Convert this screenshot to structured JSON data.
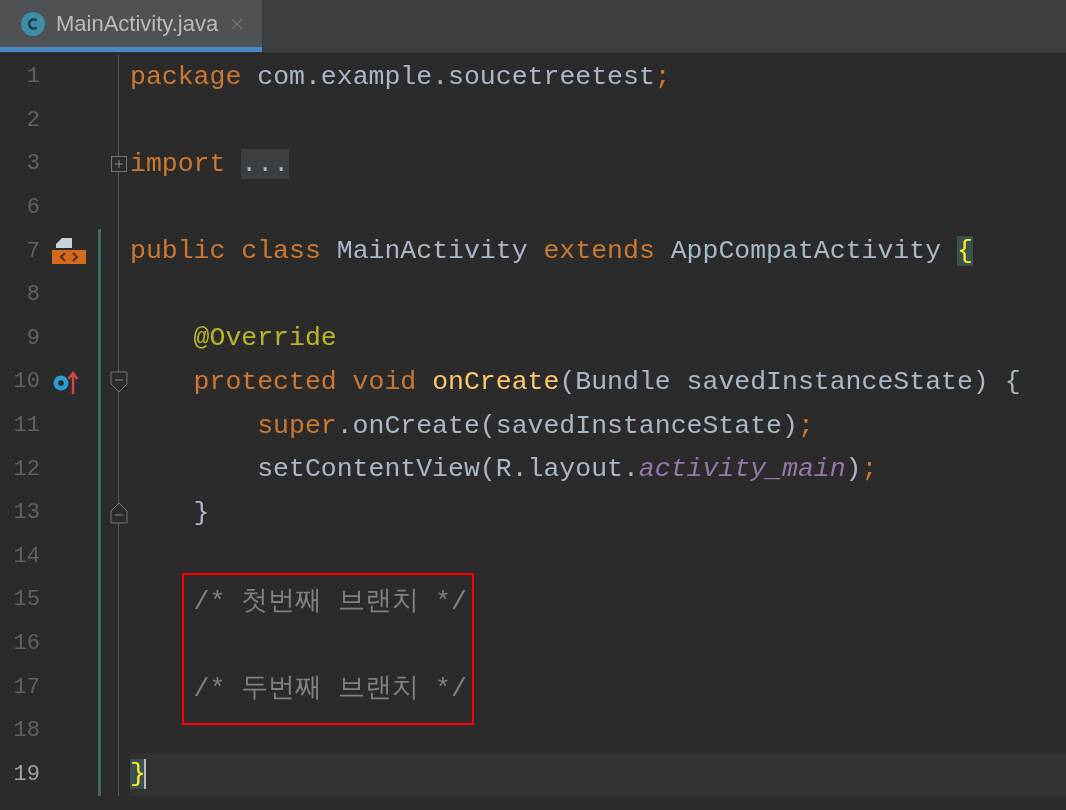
{
  "tabs": [
    {
      "label": "MainActivity.java",
      "selected": true
    }
  ],
  "editor": {
    "lines": [
      {
        "number": "1",
        "current": false,
        "changed": false,
        "indent": {
          "kind": "none"
        },
        "tokens": [
          {
            "kind": "keyword",
            "text": "package "
          },
          {
            "kind": "plain",
            "text": "com.example.soucetreetest"
          },
          {
            "kind": "keyword",
            "text": ";"
          }
        ]
      },
      {
        "number": "2",
        "current": false,
        "changed": false
      },
      {
        "number": "3",
        "current": false,
        "changed": false,
        "fold_marker": {
          "kind": "collapsed"
        },
        "indent": {
          "kind": "none"
        },
        "tokens": [
          {
            "kind": "keyword",
            "text": "import "
          },
          {
            "kind": "folded",
            "text": "..."
          }
        ]
      },
      {
        "number": "6",
        "current": false,
        "changed": false
      },
      {
        "number": "7",
        "current": false,
        "changed": true,
        "gutter_icon": {
          "kind": "layout"
        },
        "indent": {
          "kind": "none"
        },
        "tokens": [
          {
            "kind": "keyword",
            "text": "public class "
          },
          {
            "kind": "plain",
            "text": "MainActivity "
          },
          {
            "kind": "keyword",
            "text": "extends "
          },
          {
            "kind": "plain",
            "text": "AppCompatActivity "
          },
          {
            "kind": "brace",
            "text": "{"
          }
        ]
      },
      {
        "number": "8",
        "current": false,
        "changed": true
      },
      {
        "number": "9",
        "current": false,
        "changed": true,
        "indent": {
          "kind": "member"
        },
        "tokens": [
          {
            "kind": "annotation",
            "text": "@Override"
          }
        ]
      },
      {
        "number": "10",
        "current": false,
        "changed": true,
        "gutter_icon": {
          "kind": "override"
        },
        "fold_marker": {
          "kind": "start"
        },
        "indent": {
          "kind": "member"
        },
        "tokens": [
          {
            "kind": "keyword",
            "text": "protected void "
          },
          {
            "kind": "method",
            "text": "onCreate"
          },
          {
            "kind": "plain",
            "text": "(Bundle savedInstanceState) {"
          }
        ]
      },
      {
        "number": "11",
        "current": false,
        "changed": true,
        "indent": {
          "kind": "statement"
        },
        "tokens": [
          {
            "kind": "keyword",
            "text": "super"
          },
          {
            "kind": "plain",
            "text": ".onCreate(savedInstanceState)"
          },
          {
            "kind": "keyword",
            "text": ";"
          }
        ]
      },
      {
        "number": "12",
        "current": false,
        "changed": true,
        "indent": {
          "kind": "statement"
        },
        "tokens": [
          {
            "kind": "plain",
            "text": "setContentView(R.layout."
          },
          {
            "kind": "field",
            "text": "activity_main"
          },
          {
            "kind": "plain",
            "text": ")"
          },
          {
            "kind": "keyword",
            "text": ";"
          }
        ]
      },
      {
        "number": "13",
        "current": false,
        "changed": true,
        "fold_marker": {
          "kind": "end"
        },
        "indent": {
          "kind": "member"
        },
        "tokens": [
          {
            "kind": "plain",
            "text": "}"
          }
        ]
      },
      {
        "number": "14",
        "current": false,
        "changed": true
      },
      {
        "number": "15",
        "current": false,
        "changed": true,
        "boxed": true,
        "indent": {
          "kind": "member"
        },
        "tokens": [
          {
            "kind": "comment",
            "text": "/* 첫번째 브랜치 */"
          }
        ]
      },
      {
        "number": "16",
        "current": false,
        "changed": true,
        "boxed": true
      },
      {
        "number": "17",
        "current": false,
        "changed": true,
        "boxed": true,
        "indent": {
          "kind": "member"
        },
        "tokens": [
          {
            "kind": "comment",
            "text": "/* 두번째 브랜치 */"
          }
        ]
      },
      {
        "number": "18",
        "current": false,
        "changed": true
      },
      {
        "number": "19",
        "current": true,
        "changed": true,
        "indent": {
          "kind": "none"
        },
        "tokens": [
          {
            "kind": "brace",
            "text": "}"
          }
        ]
      }
    ]
  }
}
